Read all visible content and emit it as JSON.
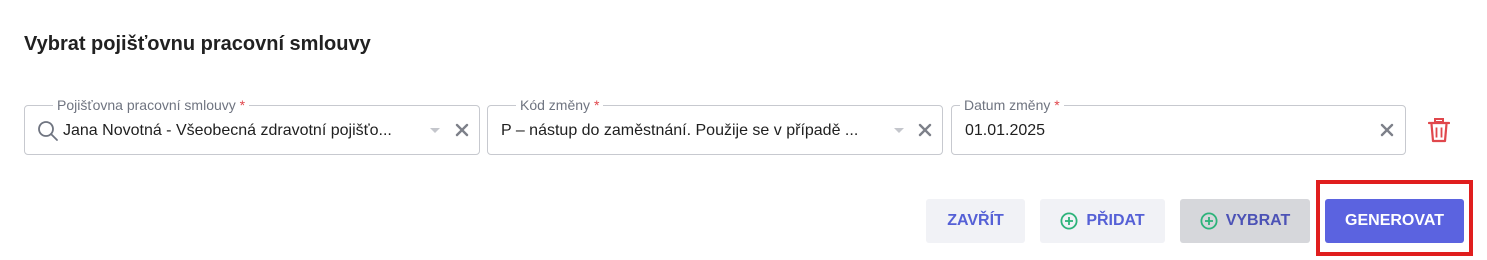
{
  "dialog": {
    "title": "Vybrat pojišťovnu pracovní smlouvy"
  },
  "fields": [
    {
      "label": "Pojišťovna pracovní smlouvy",
      "required_mark": "*",
      "value": "Jana Novotná - Všeobecná zdravotní pojišťo..."
    },
    {
      "label": "Kód změny",
      "required_mark": "*",
      "value": "P – nástup do zaměstnání. Použije se v případě ..."
    },
    {
      "label": "Datum změny",
      "required_mark": "*",
      "value": "01.01.2025"
    }
  ],
  "buttons": {
    "close": "ZAVŘÍT",
    "add": "PŘIDAT",
    "select": "VYBRAT",
    "generate": "GENEROVAT"
  },
  "colors": {
    "accent": "#5b63e0",
    "add_icon": "#2db37a",
    "delete_icon": "#e0474c",
    "highlight": "#e01e1e"
  }
}
